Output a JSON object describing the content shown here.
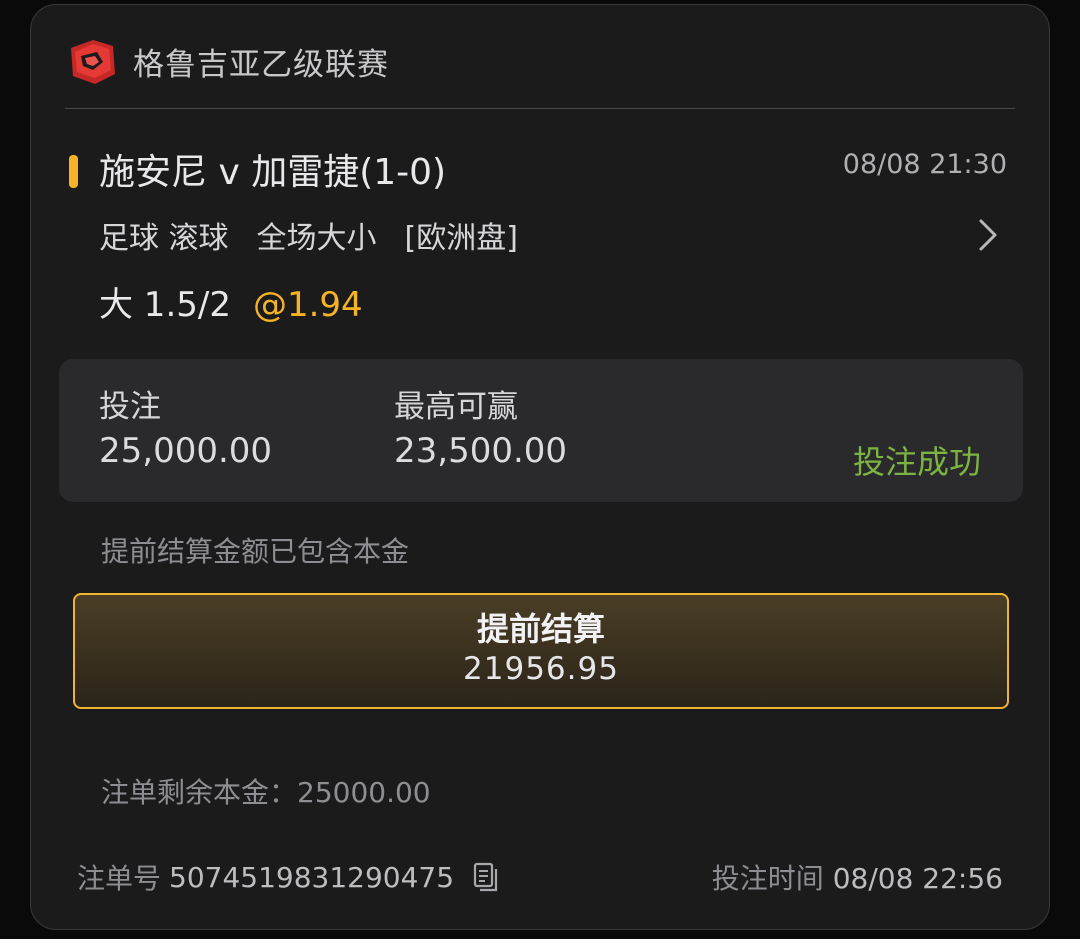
{
  "league": {
    "name": "格鲁吉亚乙级联赛",
    "logo_icon": "league-badge-icon"
  },
  "match": {
    "title": "施安尼 v 加雷捷(1-0)",
    "time": "08/08 21:30",
    "sport": "足球",
    "mode": "滚球",
    "market": "全场大小",
    "odds_type": "[欧洲盘]",
    "selection": "大 1.5/2",
    "odds": "@1.94"
  },
  "stake": {
    "label": "投注",
    "value": "25,000.00"
  },
  "max_win": {
    "label": "最高可赢",
    "value": "23,500.00"
  },
  "status": "投注成功",
  "note": "提前结算金额已包含本金",
  "cashout": {
    "label": "提前结算",
    "amount": "21956.95"
  },
  "remaining": {
    "label": "注单剩余本金：",
    "value": "25000.00"
  },
  "order": {
    "label": "注单号",
    "number": "5074519831290475"
  },
  "bet_time": {
    "label": "投注时间",
    "value": "08/08 22:56"
  },
  "colors": {
    "accent": "#f5b325",
    "success": "#7cb342",
    "card": "#1b1b1c"
  }
}
